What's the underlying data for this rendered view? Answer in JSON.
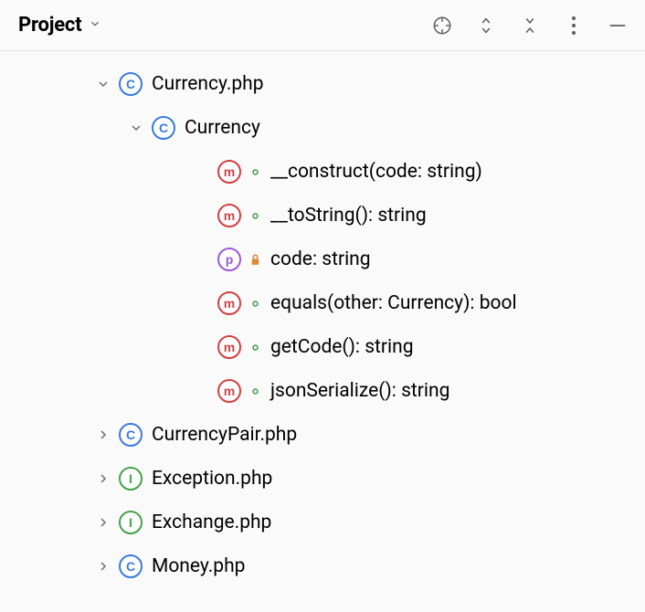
{
  "header": {
    "title": "Project"
  },
  "icons": {
    "class_letter": "C",
    "interface_letter": "I",
    "method_letter": "m",
    "property_letter": "p"
  },
  "tree": [
    {
      "indent": 0,
      "expanded": true,
      "kind": "class",
      "label": "Currency.php",
      "name": "file-currency-php"
    },
    {
      "indent": 1,
      "expanded": true,
      "kind": "class",
      "label": "Currency",
      "name": "class-currency"
    },
    {
      "indent": 2,
      "expanded": null,
      "kind": "method",
      "visibility": "public",
      "label": "__construct(code: string)",
      "name": "method-construct"
    },
    {
      "indent": 2,
      "expanded": null,
      "kind": "method",
      "visibility": "public",
      "label": "__toString(): string",
      "name": "method-tostring"
    },
    {
      "indent": 2,
      "expanded": null,
      "kind": "property",
      "visibility": "private",
      "label": "code: string",
      "name": "property-code"
    },
    {
      "indent": 2,
      "expanded": null,
      "kind": "method",
      "visibility": "public",
      "label": "equals(other: Currency): bool",
      "name": "method-equals"
    },
    {
      "indent": 2,
      "expanded": null,
      "kind": "method",
      "visibility": "public",
      "label": "getCode(): string",
      "name": "method-getcode"
    },
    {
      "indent": 2,
      "expanded": null,
      "kind": "method",
      "visibility": "public",
      "label": "jsonSerialize(): string",
      "name": "method-jsonserialize"
    },
    {
      "indent": 0,
      "expanded": false,
      "kind": "class",
      "label": "CurrencyPair.php",
      "name": "file-currencypair-php"
    },
    {
      "indent": 0,
      "expanded": false,
      "kind": "interface",
      "label": "Exception.php",
      "name": "file-exception-php"
    },
    {
      "indent": 0,
      "expanded": false,
      "kind": "interface",
      "label": "Exchange.php",
      "name": "file-exchange-php"
    },
    {
      "indent": 0,
      "expanded": false,
      "kind": "class",
      "label": "Money.php",
      "name": "file-money-php"
    }
  ]
}
